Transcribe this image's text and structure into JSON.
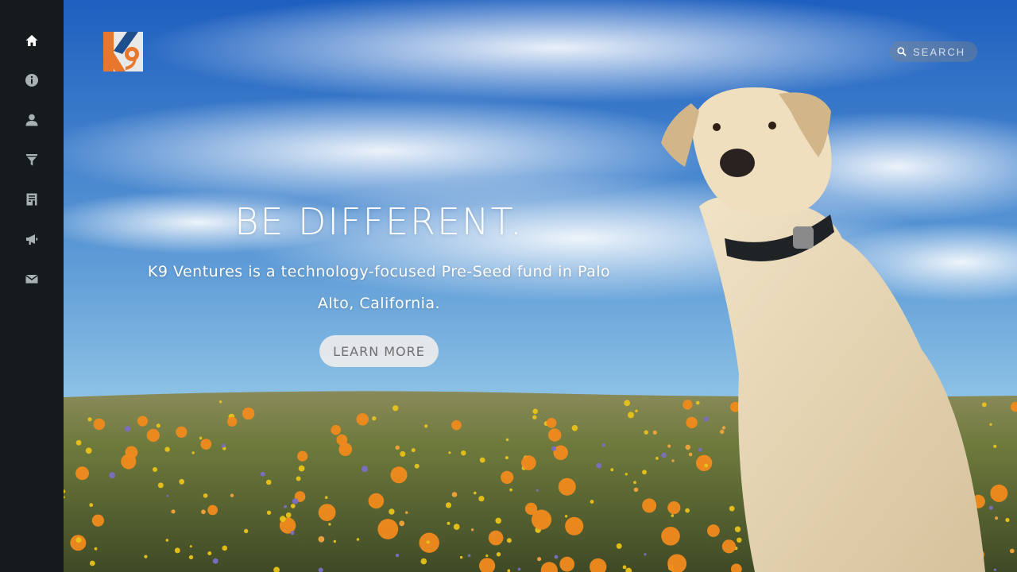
{
  "sidebar": {
    "items": [
      {
        "label": "Home",
        "icon": "home-icon",
        "active": true
      },
      {
        "label": "About",
        "icon": "info-icon"
      },
      {
        "label": "Team",
        "icon": "user-icon"
      },
      {
        "label": "Funnel",
        "icon": "funnel-icon"
      },
      {
        "label": "Portfolio",
        "icon": "building-icon"
      },
      {
        "label": "News",
        "icon": "megaphone-icon"
      },
      {
        "label": "Contact",
        "icon": "mail-icon"
      }
    ]
  },
  "header": {
    "logo_text": "K9",
    "search_placeholder": "SEARCH"
  },
  "hero": {
    "headline": "BE DIFFERENT.",
    "subtext": "K9 Ventures is a technology-focused Pre-Seed fund in Palo Alto, California.",
    "cta_label": "LEARN MORE"
  },
  "colors": {
    "sidebar_bg": "#151a1c",
    "logo_orange": "#e8772e",
    "logo_blue": "#1f4e8c",
    "sky_top": "#2f6fc0",
    "sky_bottom": "#8ec3e6",
    "poppy": "#f08a1c"
  }
}
